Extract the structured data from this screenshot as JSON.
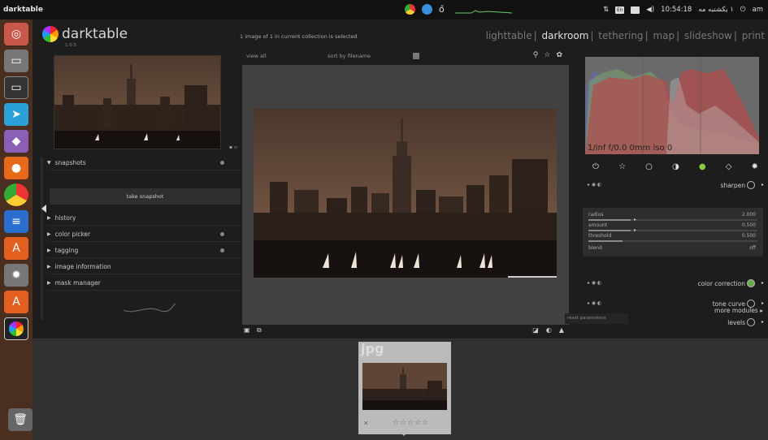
{
  "topbar": {
    "app_title": "darktable",
    "keyboard": "En",
    "clock": "10:54:18",
    "date": "١ يكشنبه مه",
    "user": "am"
  },
  "app": {
    "logo_name": "darktable",
    "version": "1.0.5",
    "collection_msg": "1 image of 1 in current collection is selected"
  },
  "views": {
    "lighttable": "lighttable",
    "darkroom": "darkroom",
    "tethering": "tethering",
    "map": "map",
    "slideshow": "slideshow",
    "print": "print"
  },
  "toolbar": {
    "view_all": "view  all",
    "sort": "sort by  filename"
  },
  "left_panel": {
    "snapshots": "snapshots",
    "take_snapshot": "take snapshot",
    "history": "history",
    "color_picker": "color picker",
    "tagging": "tagging",
    "image_information": "image information",
    "mask_manager": "mask manager"
  },
  "histogram": {
    "info": "1/inf f/0.0 0mm iso 0"
  },
  "modules": {
    "sharpen": "sharpen",
    "color_correction": "color correction",
    "tone_curve": "tone curve",
    "levels": "levels",
    "more_modules": "more modules",
    "reset_tooltip": "reset parameters"
  },
  "sharpen_params": {
    "radius_label": "radius",
    "radius_value": "2.000",
    "radius_level": 0.25,
    "amount_label": "amount",
    "amount_value": "0.500",
    "amount_level": 0.25,
    "threshold_label": "threshold",
    "threshold_value": "0.500",
    "threshold_level": 0.2,
    "blend_label": "blend",
    "blend_value": "off"
  },
  "filmstrip": {
    "extension": "jpg",
    "stars": "☆☆☆☆☆"
  },
  "colors": {
    "accent_active_group": "#88cc44",
    "launcher_bg": "#4a2e20",
    "canvas_bg": "#414141"
  }
}
